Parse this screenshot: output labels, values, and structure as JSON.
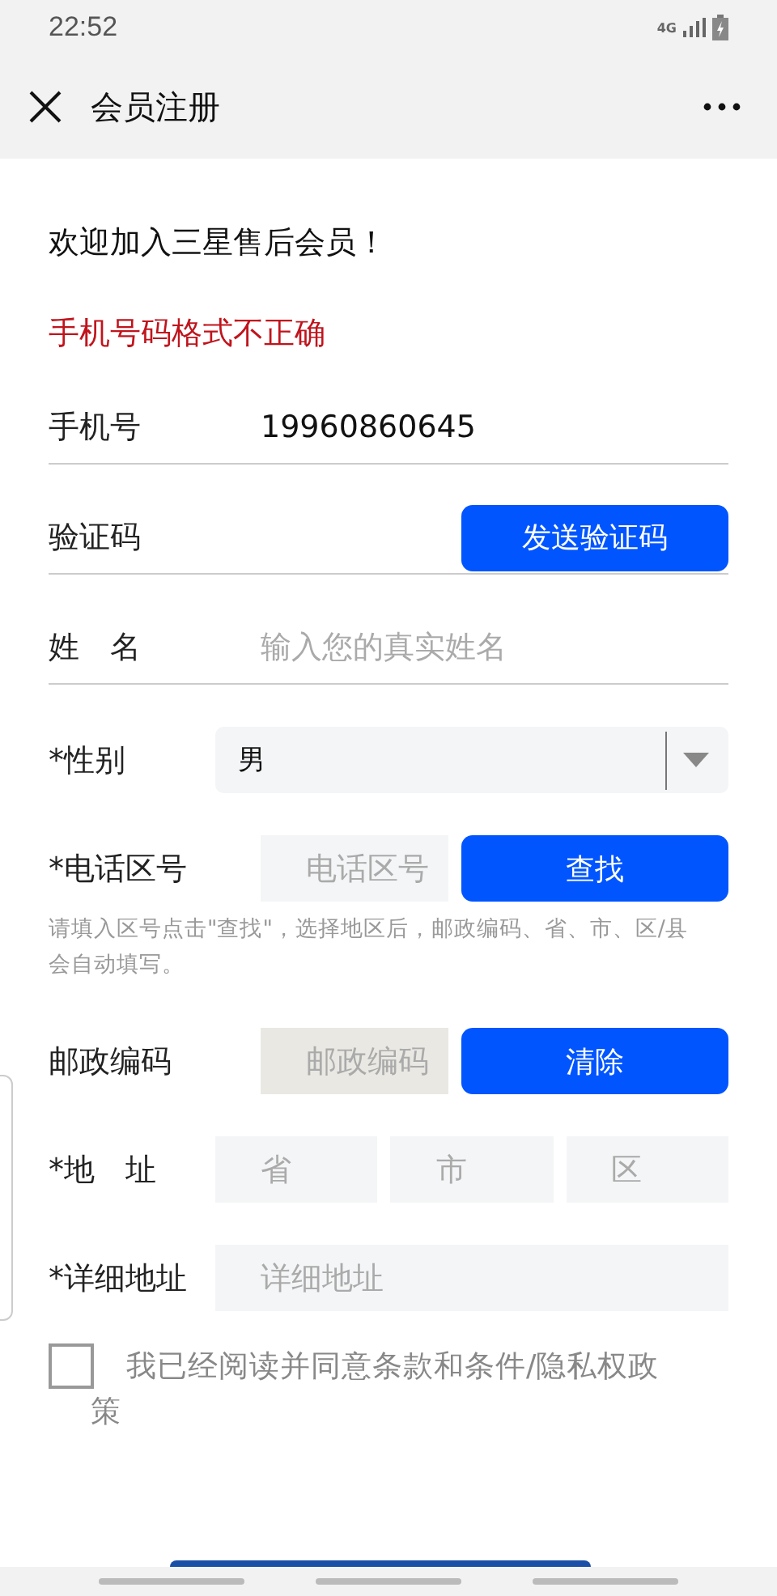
{
  "status_bar": {
    "time": "22:52",
    "network": "4G"
  },
  "header": {
    "title": "会员注册"
  },
  "welcome": "欢迎加入三星售后会员！",
  "error": "手机号码格式不正确",
  "fields": [
    {
      "kind": "text",
      "label": "手机号",
      "value": "19960860645"
    },
    {
      "kind": "code",
      "label": "验证码",
      "button": "发送验证码"
    },
    {
      "kind": "text",
      "label": "姓　名",
      "placeholder": "输入您的真实姓名"
    },
    {
      "kind": "select",
      "label": "*性别",
      "value": "男"
    },
    {
      "kind": "lookup",
      "label": "*电话区号",
      "placeholder": "电话区号",
      "button": "查找",
      "hint": "请填入区号点击\"查找\"，选择地区后，邮政编码、省、市、区/县会自动填写。"
    },
    {
      "kind": "lookup",
      "label": "邮政编码",
      "placeholder": "邮政编码",
      "button": "清除",
      "disabled": true
    },
    {
      "kind": "address",
      "label": "*地　址",
      "parts": [
        {
          "placeholder": "省"
        },
        {
          "placeholder": "市"
        },
        {
          "placeholder": "区"
        }
      ]
    },
    {
      "kind": "boxed",
      "label": "*详细地址",
      "placeholder": "详细地址"
    }
  ],
  "agreement": {
    "checked": false,
    "text": "我已经阅读并同意条款和条件/隐私权政策"
  }
}
